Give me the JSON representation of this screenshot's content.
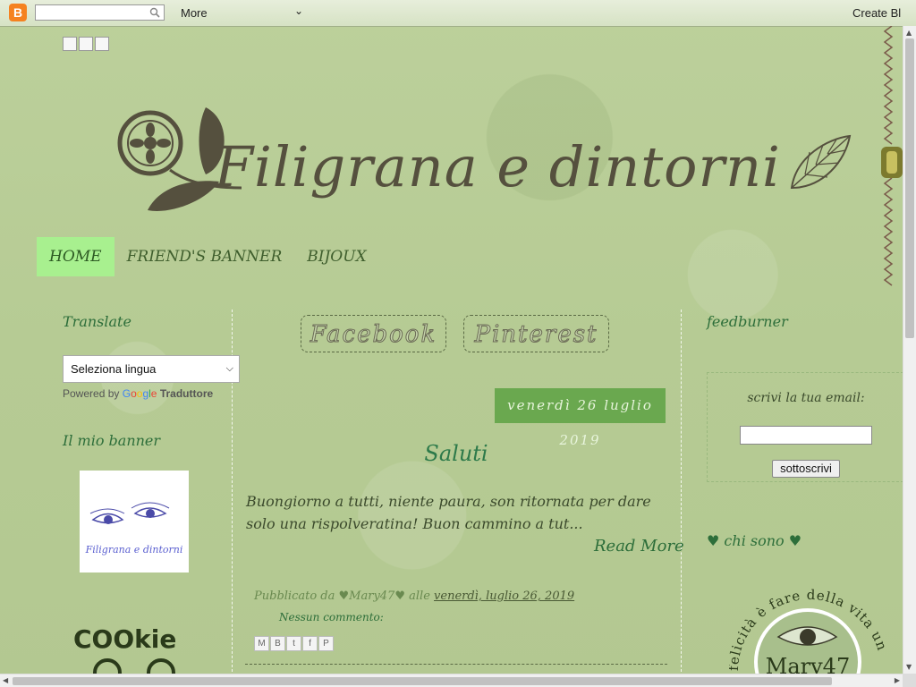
{
  "navbar": {
    "logo": "B",
    "search_placeholder": "",
    "more_label": "More",
    "more_chevron": "⌄",
    "create_label": "Create Bl"
  },
  "blog": {
    "title": "Filigrana e dintorni"
  },
  "menu": [
    {
      "label": "HOME",
      "active": true
    },
    {
      "label": "FRIEND'S BANNER",
      "active": false
    },
    {
      "label": "BIJOUX",
      "active": false
    }
  ],
  "sidebar_left": {
    "translate_title": "Translate",
    "translate_select_value": "Seleziona lingua",
    "powered_prefix": "Powered by",
    "google_letters": [
      "G",
      "o",
      "o",
      "g",
      "l",
      "e"
    ],
    "powered_suffix": "Traduttore",
    "banner_title": "Il mio banner",
    "banner_caption": "Filigrana e dintorni",
    "cookie_text": "COOkie"
  },
  "main": {
    "social": [
      "Facebook",
      "Pinterest"
    ],
    "date": "venerdì 26 luglio 2019",
    "post_title": "Saluti",
    "post_body": "Buongiorno a tutti, niente paura, son ritornata per dare solo una rispolveratina! Buon cammino a tut...",
    "read_more": "Read More",
    "footer_published": "Pubblicato da",
    "footer_author": "♥Mary47♥",
    "footer_at": "alle",
    "footer_date": "venerdì, luglio 26, 2019",
    "comments": "Nessun commento:",
    "share_buttons": [
      "M",
      "B",
      "t",
      "f",
      "P"
    ]
  },
  "sidebar_right": {
    "feed_title": "feedburner",
    "feed_label": "scrivi la tua email:",
    "feed_input_value": "",
    "feed_button": "sottoscrivi",
    "chi_sono_title": "♥ chi sono ♥",
    "chi_sono_arc_text": "felicità è fare della vita un",
    "chi_sono_name": "Mary47"
  },
  "colors": {
    "background": "#b9cc98",
    "menu_active": "#a8f08f",
    "date_header": "#6aa84f",
    "accent_green": "#2d6e3a"
  }
}
